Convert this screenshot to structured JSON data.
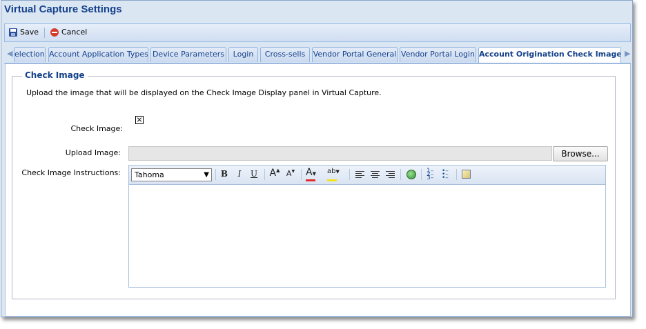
{
  "window": {
    "title": "Virtual Capture Settings"
  },
  "toolbar": {
    "save_label": "Save",
    "cancel_label": "Cancel"
  },
  "tabs": [
    {
      "label": "election"
    },
    {
      "label": "Account Application Types"
    },
    {
      "label": "Device Parameters"
    },
    {
      "label": "Login"
    },
    {
      "label": "Cross-sells"
    },
    {
      "label": "Vendor Portal General"
    },
    {
      "label": "Vendor Portal Login"
    },
    {
      "label": "Account Origination Check Image",
      "active": true
    }
  ],
  "section": {
    "legend": "Check Image",
    "description": "Upload the image that will be displayed on the Check Image Display panel in Virtual Capture."
  },
  "form": {
    "check_image_label": "Check Image:",
    "upload_label": "Upload Image:",
    "upload_value": "",
    "browse_label": "Browse...",
    "instructions_label": "Check Image Instructions:"
  },
  "editor": {
    "font_name": "Tahoma",
    "bold": "B",
    "italic": "I",
    "underline": "U",
    "grow_font": "A",
    "shrink_font": "A",
    "font_color": "A",
    "highlight": "ab",
    "content": ""
  },
  "colors": {
    "title": "#15428b",
    "accent": "#99bbe8",
    "font_color_bar": "#e32b2b",
    "highlight_bar": "#f5e21c"
  }
}
